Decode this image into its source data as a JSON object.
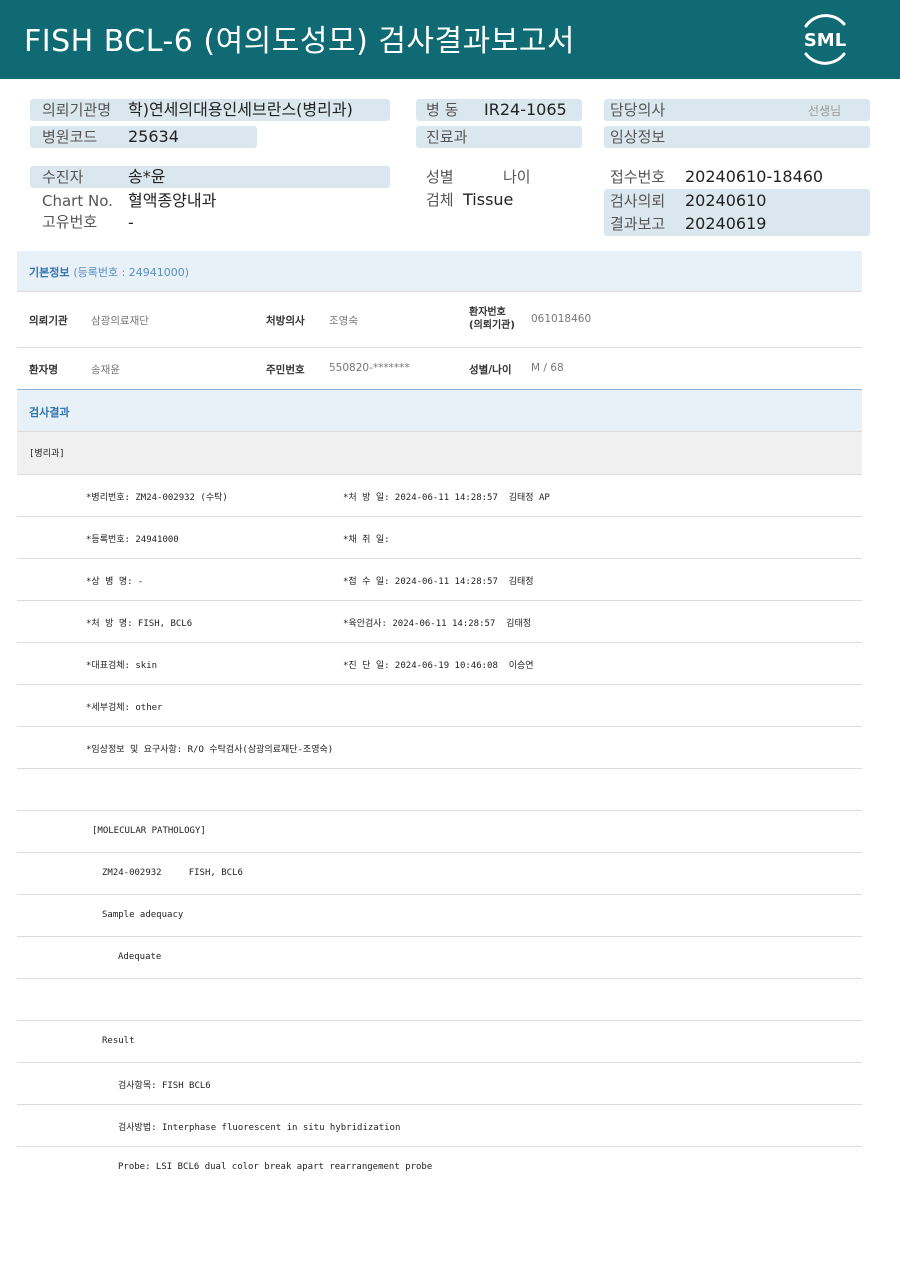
{
  "header": {
    "title": "FISH BCL-6 (여의도성모) 검사결과보고서",
    "logo_text": "SML"
  },
  "info": {
    "institution_label": "의뢰기관명",
    "institution_value": "학)연세의대용인세브란스(병리과)",
    "ward_label": "병 동",
    "ward_value": "IR24-1065",
    "doctor_label": "담당의사",
    "doctor_suffix": "선생님",
    "hospital_code_label": "병원코드",
    "hospital_code_value": "25634",
    "dept_label": "진료과",
    "clinical_info_label": "임상정보",
    "patient_label": "수진자",
    "patient_value": "송*윤",
    "sex_label": "성별",
    "age_label": "나이",
    "receipt_no_label": "접수번호",
    "receipt_no_value": "20240610-18460",
    "chart_label": "Chart No.",
    "chart_value": "혈액종양내과",
    "specimen_label": "검체",
    "specimen_value": "Tissue",
    "request_label": "검사의뢰",
    "request_value": "20240610",
    "unique_no_label": "고유번호",
    "unique_no_value": "-",
    "report_label": "결과보고",
    "report_value": "20240619"
  },
  "basic_info": {
    "section_title": "기본정보",
    "reg_no_note": "(등록번호 : 24941000)",
    "institution_label": "의뢰기관",
    "institution_value": "삼광의료재단",
    "prescriber_label": "처방의사",
    "prescriber_value": "조영숙",
    "patient_no_label_1": "환자번호",
    "patient_no_label_2": "(의뢰기관)",
    "patient_no_value": "061018460",
    "patient_name_label": "환자명",
    "patient_name_value": "송재윤",
    "rrn_label": "주민번호",
    "rrn_value": "550820-*******",
    "sex_age_label": "성별/나이",
    "sex_age_value": "M / 68"
  },
  "results": {
    "section_title": "검사결과",
    "dept_tag": "[병리과]",
    "rows": [
      {
        "left": "*병리번호: ZM24-002932 (수탁)",
        "right": "*처 방 일: 2024-06-11 14:28:57  김태정 AP"
      },
      {
        "left": "*등록번호: 24941000",
        "right": "*채 취 일:"
      },
      {
        "left": "*상 병 명: -",
        "right": "*접 수 일: 2024-06-11 14:28:57  김태정"
      },
      {
        "left": "*처 방 명: FISH, BCL6",
        "right": "*육안검사: 2024-06-11 14:28:57  김태정"
      },
      {
        "left": "*대표검체: skin",
        "right": "*진 단 일: 2024-06-19 10:46:08  이승연"
      },
      {
        "left": "*세부검체: other",
        "right": ""
      },
      {
        "left": "*임상정보 및 요구사항: R/O 수탁검사(삼광의료재단-조영숙)",
        "right": ""
      }
    ],
    "report_lines": [
      {
        "text": "",
        "indent": 0
      },
      {
        "text": "[MOLECULAR PATHOLOGY]",
        "indent": 1
      },
      {
        "text": "ZM24-002932     FISH, BCL6",
        "indent": 2
      },
      {
        "text": "Sample adequacy",
        "indent": 2
      },
      {
        "text": "Adequate",
        "indent": 3
      },
      {
        "text": "",
        "indent": 0
      },
      {
        "text": "Result",
        "indent": 2
      },
      {
        "text": "검사항목: FISH BCL6",
        "indent": 3
      },
      {
        "text": "검사방법: Interphase fluorescent in situ hybridization",
        "indent": 3
      },
      {
        "text": "Probe: LSI BCL6 dual color break apart rearrangement probe",
        "indent": 3
      }
    ]
  },
  "colors": {
    "header_bg": "#0f6a73",
    "pill_bg": "#dbe7ee",
    "section_bg": "#e8f1f7",
    "accent_blue": "#2f74b3"
  }
}
